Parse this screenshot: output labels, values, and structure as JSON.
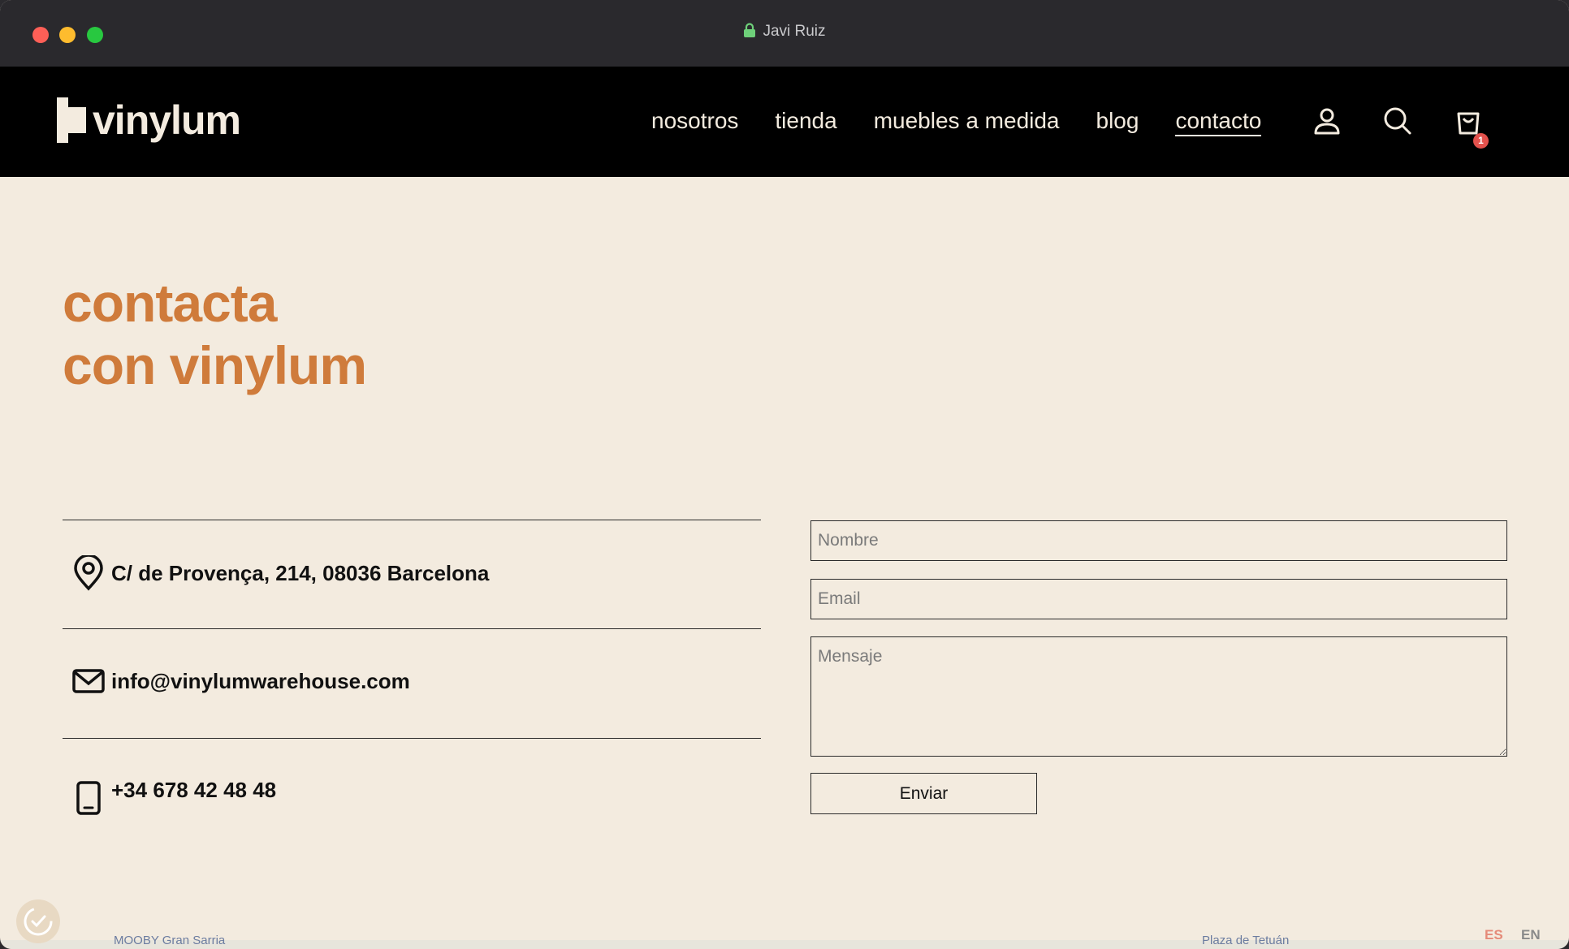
{
  "browser": {
    "title": "Javi Ruiz",
    "icons": [
      "lock-icon"
    ]
  },
  "site": {
    "logo_text": "vinylum",
    "nav": [
      {
        "label": "nosotros"
      },
      {
        "label": "tienda"
      },
      {
        "label": "muebles a medida"
      },
      {
        "label": "blog"
      },
      {
        "label": "contacto",
        "active": true
      }
    ],
    "nav_icons": [
      "user-icon",
      "search-icon",
      "cart-icon"
    ],
    "cart_count": "1"
  },
  "hero": {
    "line1": "contacta",
    "line2": "con vinylum"
  },
  "contact": {
    "address": "C/ de Provença, 214, 08036 Barcelona",
    "email": "info@vinylumwarehouse.com",
    "phone": "+34  678 42 48 48",
    "icons": [
      "location-pin-icon",
      "mail-icon",
      "phone-icon"
    ]
  },
  "form": {
    "name_placeholder": "Nombre",
    "email_placeholder": "Email",
    "message_placeholder": "Mensaje",
    "submit_label": "Enviar"
  },
  "map": {
    "labels": [
      "MOOBY Gran Sarria",
      "Plaza de Tetuán"
    ]
  },
  "language": {
    "es": "ES",
    "en": "EN"
  },
  "colors": {
    "accent": "#cf7b3b",
    "background": "#f3ebdf",
    "header": "#000000"
  }
}
